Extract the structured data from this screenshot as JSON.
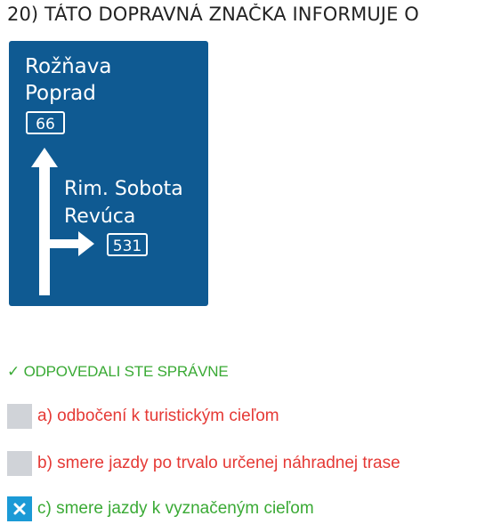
{
  "question": {
    "title": "20) TÁTO DOPRAVNÁ ZNAČKA INFORMUJE O"
  },
  "sign": {
    "background_color": "#0f5a92",
    "top_destinations": [
      "Rožňava",
      "Poprad"
    ],
    "top_route": "66",
    "side_destinations": [
      "Rim. Sobota",
      "Revúca"
    ],
    "side_route": "531"
  },
  "status": {
    "text": "✓ ODPOVEDALI STE SPRÁVNE",
    "color": "#3aaa35"
  },
  "answers": [
    {
      "label": "a) odbočení k turistickým cieľom",
      "checked": false,
      "state": "wrong"
    },
    {
      "label": "b) smere jazdy po trvalo určenej náhradnej trase",
      "checked": false,
      "state": "wrong"
    },
    {
      "label": "c) smere jazdy k vyznačeným cieľom",
      "checked": true,
      "state": "correct",
      "icon": "close-x-icon"
    }
  ],
  "colors": {
    "wrong": "#e53935",
    "correct": "#3aaa35",
    "checkbox_checked": "#1b9ad6",
    "checkbox_unchecked": "#d0d3d8"
  }
}
